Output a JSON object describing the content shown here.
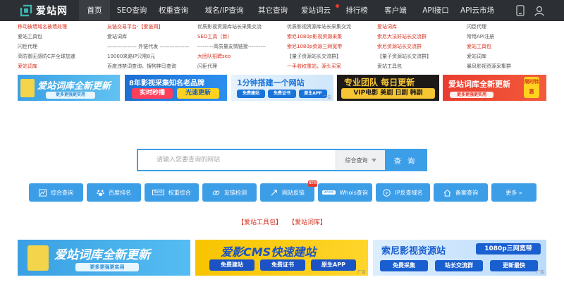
{
  "nav": {
    "logo_text": "爱站网",
    "items": [
      {
        "label": "首页",
        "active": true
      },
      {
        "label": "SEO查询"
      },
      {
        "label": "权重查询"
      },
      {
        "label": "域名/IP查询"
      },
      {
        "label": "其它查询"
      },
      {
        "label": "爱站词云",
        "dot": true
      },
      {
        "label": "排行榜"
      },
      {
        "label": "客户端"
      },
      {
        "label": "API接口"
      },
      {
        "label": "API云市场"
      }
    ],
    "icons": [
      "mobile-icon",
      "user-icon"
    ]
  },
  "links": {
    "col1": [
      "移动被墙域名被墙处理",
      "爱站工具包",
      "闪臣代理",
      "高防御无感防C并全球加速",
      "爱站词库"
    ],
    "col2": [
      "友链交易平台-【爱链网】",
      "爱站词库",
      "—————— 外链代发 ——————",
      "10000来路IP只需8元",
      "百度违禁词查询，搜狗神马查询"
    ],
    "col3": [
      "优质影视资源库站长采集交流",
      "SEO工具（新）",
      "---------高质量友情链接----------",
      "大团队招聘seo",
      "闪臣代理"
    ],
    "col4": [
      "优质影视资源库站长采集交流",
      "索尼1080p影视资源采集",
      "索尼1080p资源三网宽带",
      "【量子资源站长交流群】",
      "一手收权重站，源头买家"
    ],
    "col5": [
      "爱站词库",
      "索尼大法好站长交流群",
      "索尼资源站长交流群",
      "【量子资源站长交流群】",
      "爱站工具包"
    ],
    "col6": [
      "闪臣代理",
      "常用API注册",
      "爱站工具包",
      "爱站词库",
      "暴风影视资源采集群"
    ]
  },
  "ads": {
    "a1": {
      "title": "爱站词库全新更新",
      "sub": "更多更强更实用"
    },
    "a2": {
      "title": "8年影视采集知名老品牌",
      "pill1": "实时秒播",
      "pill2": "光速更新"
    },
    "a3": {
      "title": "1分钟搭建一个网站",
      "pill1": "免费建站",
      "pill2": "免费证书",
      "pill3": "原生APP"
    },
    "a4": {
      "title": "专业团队 每日更新",
      "pill": "VIP电影 美剧 日剧 韩剧"
    },
    "a5": {
      "title": "爱站词库全新更新",
      "sub": "更多更强更实用",
      "badge": "限时特惠"
    },
    "tag": "广告"
  },
  "search": {
    "placeholder": "请输入您要查询的网站",
    "select": "综合查询",
    "button": "查 询"
  },
  "tools": [
    {
      "label": "综合查询",
      "icon": "chart-icon"
    },
    {
      "label": "百度排名",
      "icon": "baidu-paw-icon"
    },
    {
      "label": "权重综合",
      "icon": "rank-icon"
    },
    {
      "label": "友链检测",
      "icon": "link-icon"
    },
    {
      "label": "网站反链",
      "icon": "backlink-icon",
      "badge": "NEW"
    },
    {
      "label": "Whois查询",
      "icon": "whois-icon"
    },
    {
      "label": "IP反查域名",
      "icon": "ip-icon"
    },
    {
      "label": "备案查询",
      "icon": "house-icon"
    },
    {
      "label": "更多 »",
      "icon": ""
    }
  ],
  "center_links": [
    "【爱站工具包】",
    "【爱站词库】"
  ],
  "banners": {
    "b1": {
      "title": "爱站词库全新更新",
      "sub": "更多更强更实用"
    },
    "b2": {
      "title": "爱影CMS快速建站",
      "pill1": "免费建站",
      "pill2": "免费证书",
      "pill3": "原生APP"
    },
    "b3": {
      "title": "索尼影视资源站",
      "badge": "1080p三网宽带",
      "pill1": "免费采集",
      "pill2": "站长交流群",
      "pill3": "更新最快"
    }
  },
  "colors": {
    "nav_bg": "#2c2f33",
    "accent": "#3d9ee8",
    "link_red": "#d7321f"
  }
}
